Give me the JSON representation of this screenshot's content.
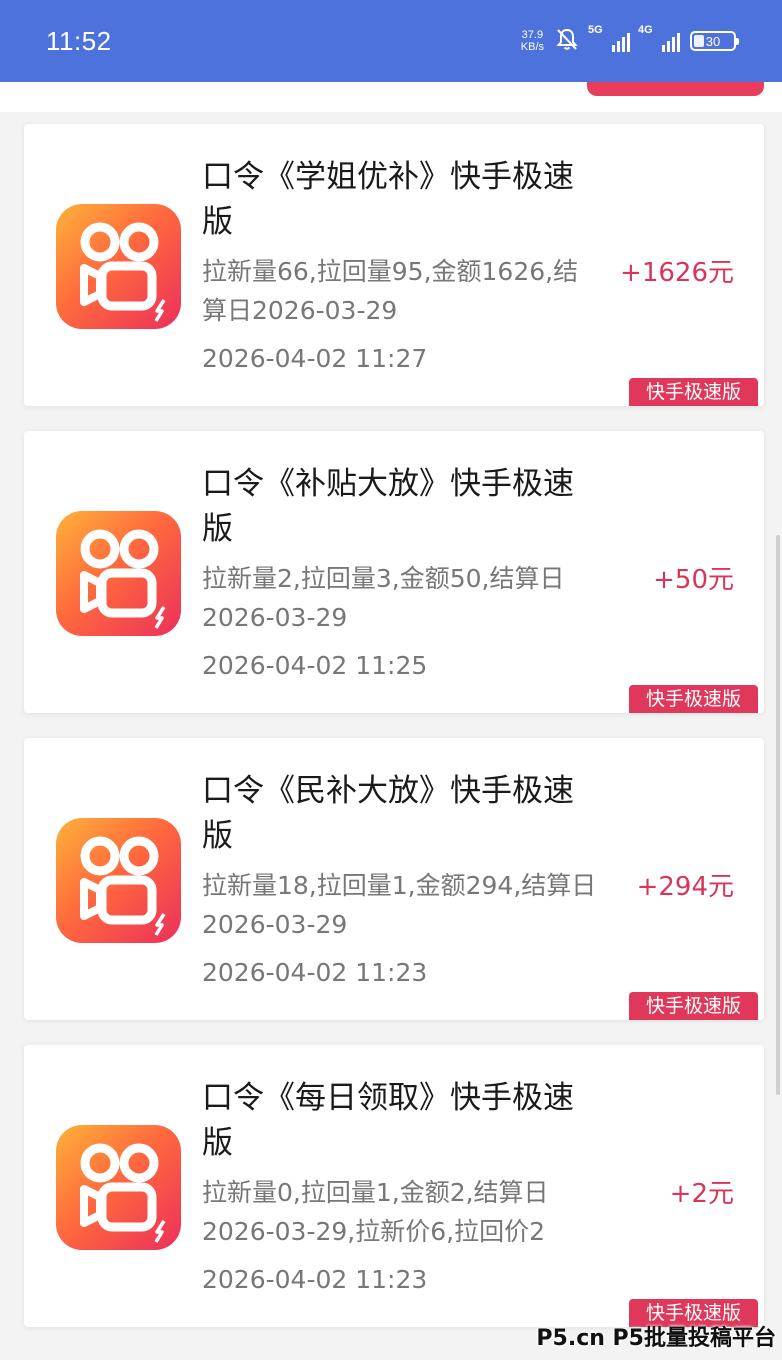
{
  "status_bar": {
    "time": "11:52",
    "net_speed_value": "37.9",
    "net_speed_unit": "KB/s",
    "signal_1": "5G",
    "signal_2": "4G",
    "battery": "30"
  },
  "cards": [
    {
      "title": "口令《学姐优补》快手极速版",
      "detail": "拉新量66,拉回量95,金额1626,结算日2026-03-29",
      "timestamp": "2026-04-02 11:27",
      "amount": "+1626元",
      "tag": "快手极速版",
      "icon": "kuaishou-app-icon"
    },
    {
      "title": "口令《补贴大放》快手极速版",
      "detail": "拉新量2,拉回量3,金额50,结算日2026-03-29",
      "timestamp": "2026-04-02 11:25",
      "amount": "+50元",
      "tag": "快手极速版",
      "icon": "kuaishou-app-icon"
    },
    {
      "title": "口令《民补大放》快手极速版",
      "detail": "拉新量18,拉回量1,金额294,结算日2026-03-29",
      "timestamp": "2026-04-02 11:23",
      "amount": "+294元",
      "tag": "快手极速版",
      "icon": "kuaishou-app-icon"
    },
    {
      "title": "口令《每日领取》快手极速版",
      "detail": "拉新量0,拉回量1,金额2,结算日2026-03-29,拉新价6,拉回价2",
      "timestamp": "2026-04-02 11:23",
      "amount": "+2元",
      "tag": "快手极速版",
      "icon": "kuaishou-app-icon"
    }
  ],
  "watermark": "P5.cn P5批量投稿平台",
  "colors": {
    "status_bar": "#4d72dc",
    "accent": "#e0385a",
    "amount": "#d8355a"
  }
}
